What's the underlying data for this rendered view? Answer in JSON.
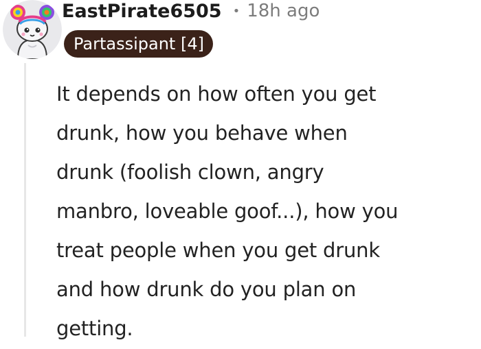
{
  "comment": {
    "username": "EastPirate6505",
    "separator": "•",
    "timestamp": "18h ago",
    "flair": "Partassipant [4]",
    "avatar_icon": "snoo-avatar-icon",
    "body_lines": [
      "It depends on how often you get",
      "drunk, how you behave when",
      "drunk (foolish clown, angry",
      "manbro, loveable goof...), how you",
      "treat people when you get drunk",
      "and how drunk do you plan on",
      "getting."
    ]
  },
  "colors": {
    "flair_bg": "#3b2219",
    "flair_text": "#ffffff",
    "meta_text": "#7c7c7c",
    "thread_line": "#e7e7e7"
  }
}
